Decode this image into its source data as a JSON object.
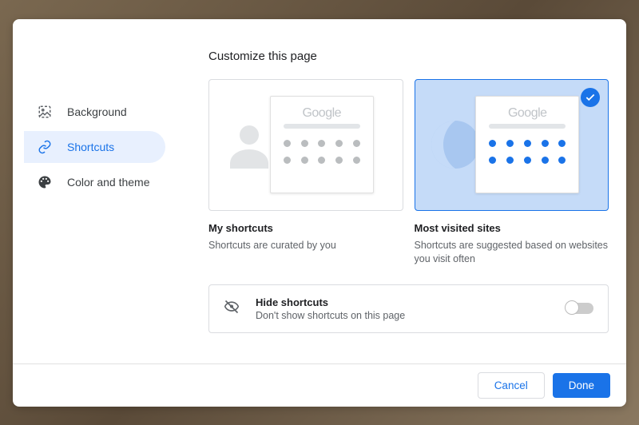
{
  "title": "Customize this page",
  "sidebar": {
    "items": [
      {
        "label": "Background"
      },
      {
        "label": "Shortcuts"
      },
      {
        "label": "Color and theme"
      }
    ]
  },
  "options": {
    "my": {
      "title": "My shortcuts",
      "desc": "Shortcuts are curated by you",
      "preview_logo": "Google"
    },
    "most": {
      "title": "Most visited sites",
      "desc": "Shortcuts are suggested based on websites you visit often",
      "preview_logo": "Google"
    }
  },
  "hide": {
    "title": "Hide shortcuts",
    "desc": "Don't show shortcuts on this page"
  },
  "footer": {
    "cancel": "Cancel",
    "done": "Done"
  },
  "colors": {
    "accent": "#1a73e8"
  }
}
